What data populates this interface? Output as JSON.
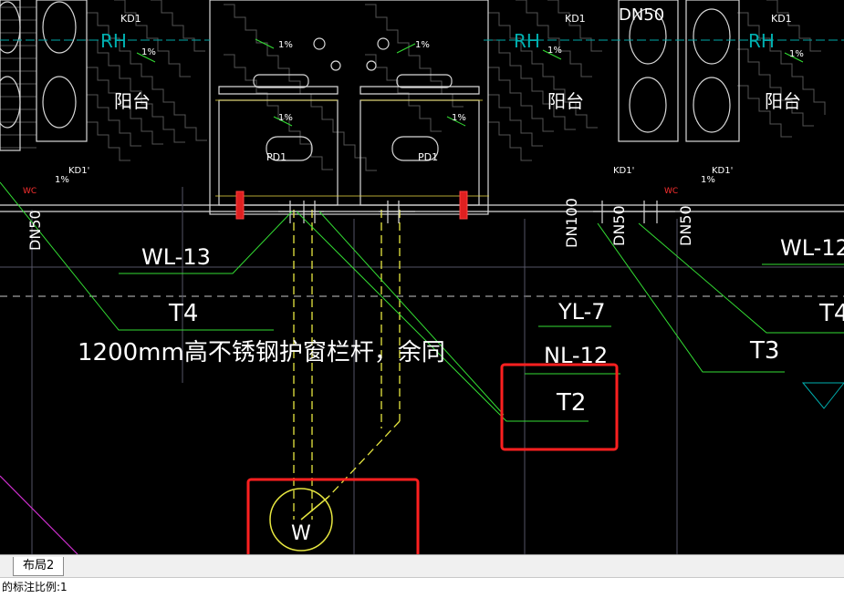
{
  "drawing": {
    "labels": {
      "rh": "RH",
      "kd1": "KD1",
      "kd1_prime": "KD1'",
      "dn50": "DN50",
      "dn100": "DN100",
      "balcony": "阳台",
      "pd1": "PD1",
      "slope": "1%",
      "wl13": "WL-13",
      "wl12": "WL-12",
      "t4": "T4",
      "t3": "T3",
      "t2": "T2",
      "yl7": "YL-7",
      "nl12": "NL-12",
      "w": "W",
      "ws": "WC",
      "railing_note": "1200mm高不锈钢护窗栏杆，余同"
    },
    "colors": {
      "background": "#000000",
      "wall": "#c8c8c8",
      "leader": "#33dd33",
      "pipe": "#e6e640",
      "highlight": "#ff2020",
      "rh": "#00b0b0",
      "text": "#ffffff"
    }
  },
  "tabs": {
    "layout2": "布局2"
  },
  "command_line": {
    "text": "的标注比例:1"
  }
}
